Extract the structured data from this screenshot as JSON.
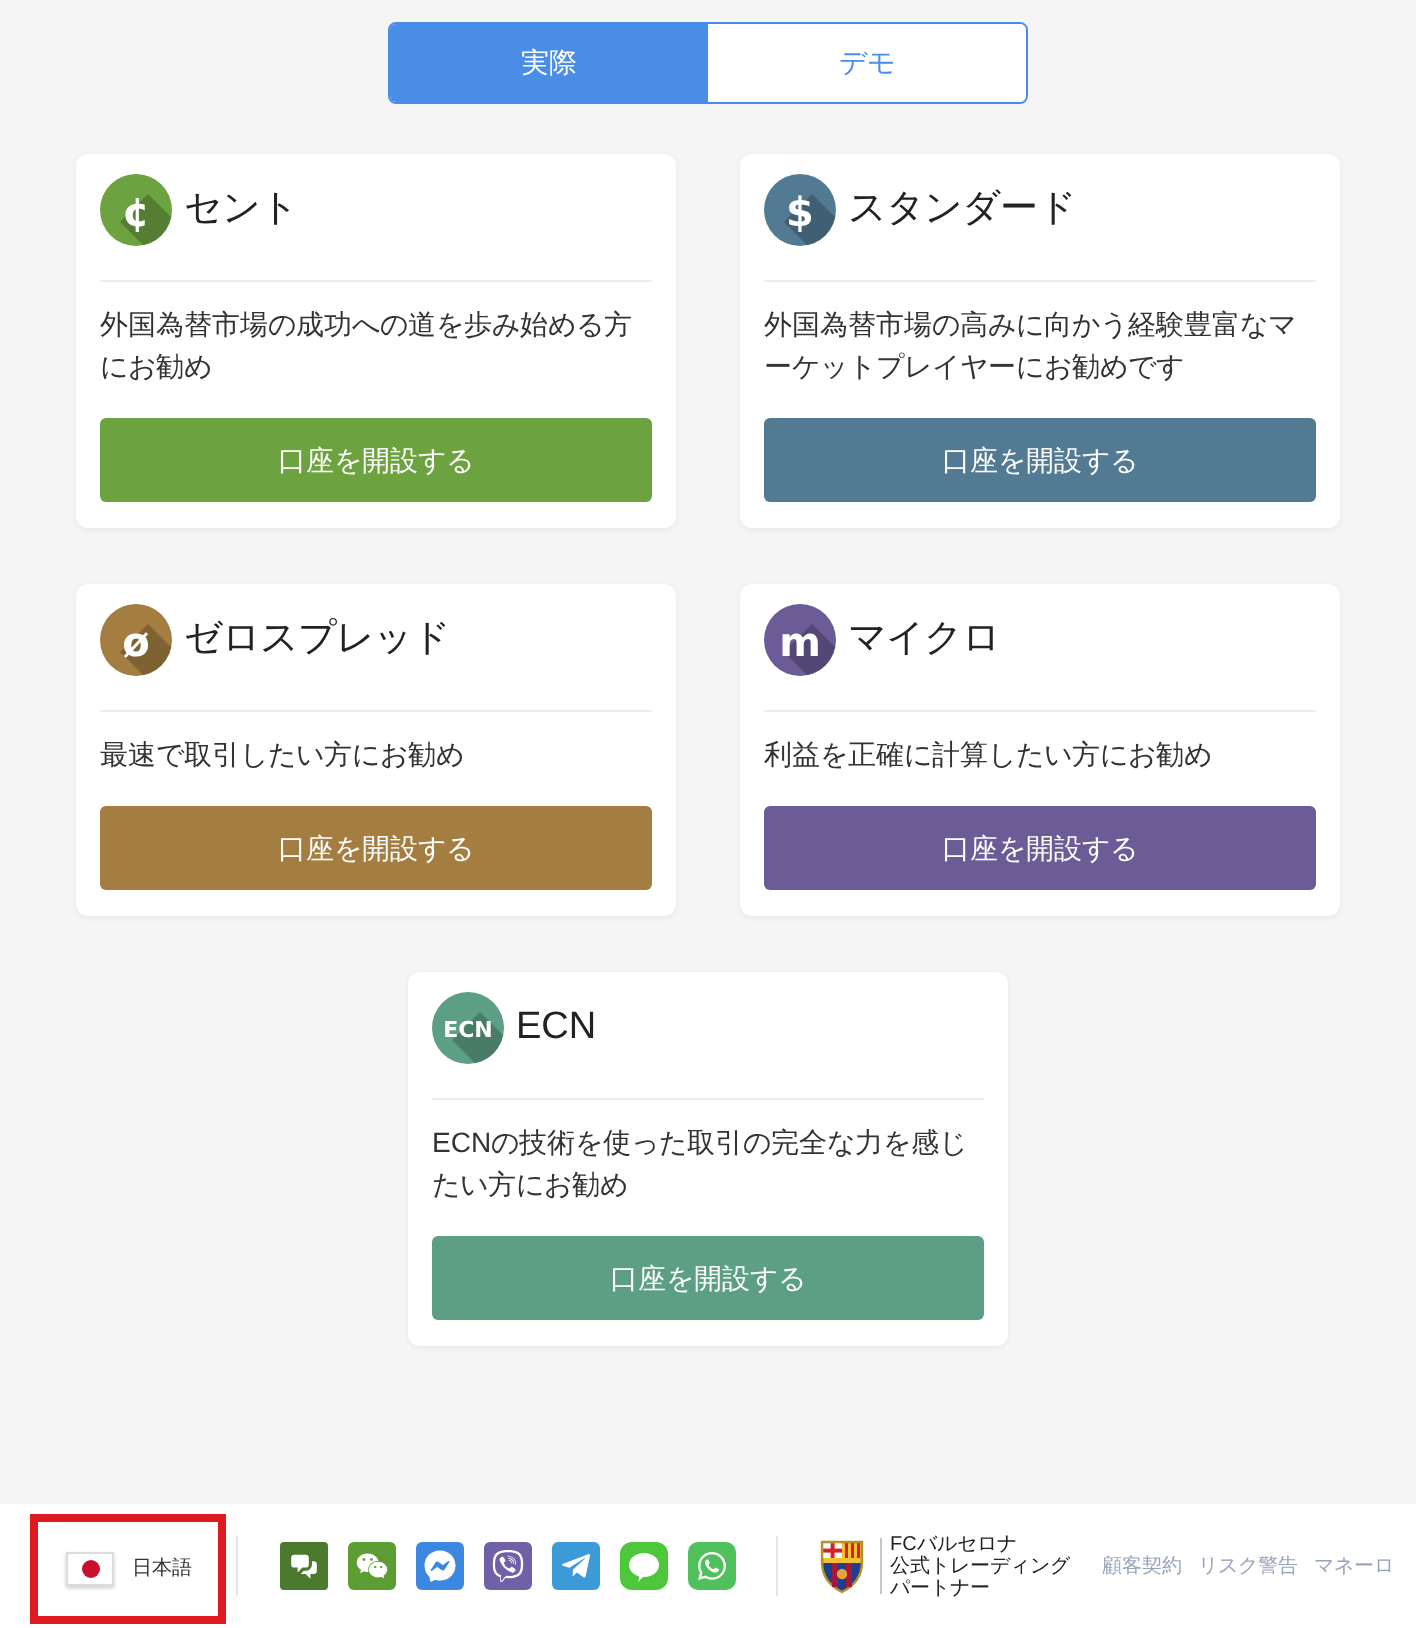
{
  "mode_tabs": [
    {
      "label": "実際",
      "selected": true
    },
    {
      "label": "デモ",
      "selected": false
    }
  ],
  "accounts": [
    {
      "title": "セント",
      "icon_text": "¢",
      "color": "#6ca23f",
      "description": "外国為替市場の成功への道を歩み始める方にお勧め",
      "button": "口座を開設する"
    },
    {
      "title": "スタンダード",
      "icon_text": "$",
      "color": "#527a92",
      "description": "外国為替市場の高みに向かう経験豊富なマーケットプレイヤーにお勧めです",
      "button": "口座を開設する"
    },
    {
      "title": "ゼロスプレッド",
      "icon_text": "ø",
      "color": "#a37e40",
      "description": "最速で取引したい方にお勧め",
      "button": "口座を開設する"
    },
    {
      "title": "マイクロ",
      "icon_text": "m",
      "color": "#6b5b96",
      "description": "利益を正確に計算したい方にお勧め",
      "button": "口座を開設する"
    },
    {
      "title": "ECN",
      "icon_text": "ECN",
      "color": "#5d9f84",
      "description": "ECNの技術を使った取引の完全な力を感じたい方にお勧め",
      "button": "口座を開設する"
    }
  ],
  "footer": {
    "language": {
      "label": "日本語",
      "highlighted": true
    },
    "social": [
      {
        "kind": "chat",
        "color": "#4b7a2e"
      },
      {
        "kind": "wechat",
        "color": "#5c9e33"
      },
      {
        "kind": "messenger",
        "color": "#3c88e0"
      },
      {
        "kind": "viber",
        "color": "#7060a8"
      },
      {
        "kind": "telegram",
        "color": "#3d9ad8"
      },
      {
        "kind": "line",
        "color": "#4cc83a"
      },
      {
        "kind": "whatsapp",
        "color": "#4fc05c"
      }
    ],
    "partner": {
      "title": "FCバルセロナ",
      "subtitle": "公式トレーディングパートナー"
    },
    "links": [
      "顧客契約",
      "リスク警告",
      "マネーロ"
    ]
  }
}
